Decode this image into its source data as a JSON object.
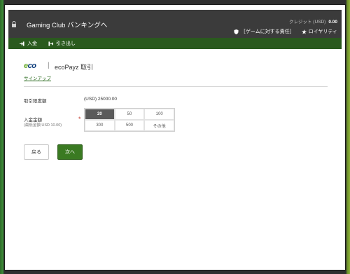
{
  "header": {
    "title": "Gaming Club バンキングへ",
    "credit_label": "クレジット (USD)",
    "credit_value": "0.00",
    "responsible_gaming": "［ゲームに対する責任］",
    "loyalty": "ロイヤリティ",
    "close_symbol": "✕"
  },
  "subnav": {
    "items": [
      {
        "label": "入金",
        "icon": "deposit-icon"
      },
      {
        "label": "引き出し",
        "icon": "withdraw-icon"
      }
    ]
  },
  "content": {
    "logo_text_e": "e",
    "logo_text_co": "co",
    "separator": "|",
    "heading": "ecoPayz 取引",
    "signup_link": "サインアップ",
    "limit_label": "取引限度額",
    "limit_value": "(USD) 25000.00",
    "amount_label": "入金金額",
    "amount_sublabel": "(最低金額 USD 10.00)",
    "required_mark": "*",
    "amount_options": [
      "20",
      "50",
      "100",
      "300",
      "500",
      "その他"
    ],
    "selected_option": "20",
    "back_button": "戻る",
    "next_button": "次へ"
  },
  "colors": {
    "header_bg": "#3b3b3b",
    "subnav_bg": "#2a5a1e",
    "primary_button": "#3a7a22",
    "selected_cell": "#5a5a5a"
  }
}
